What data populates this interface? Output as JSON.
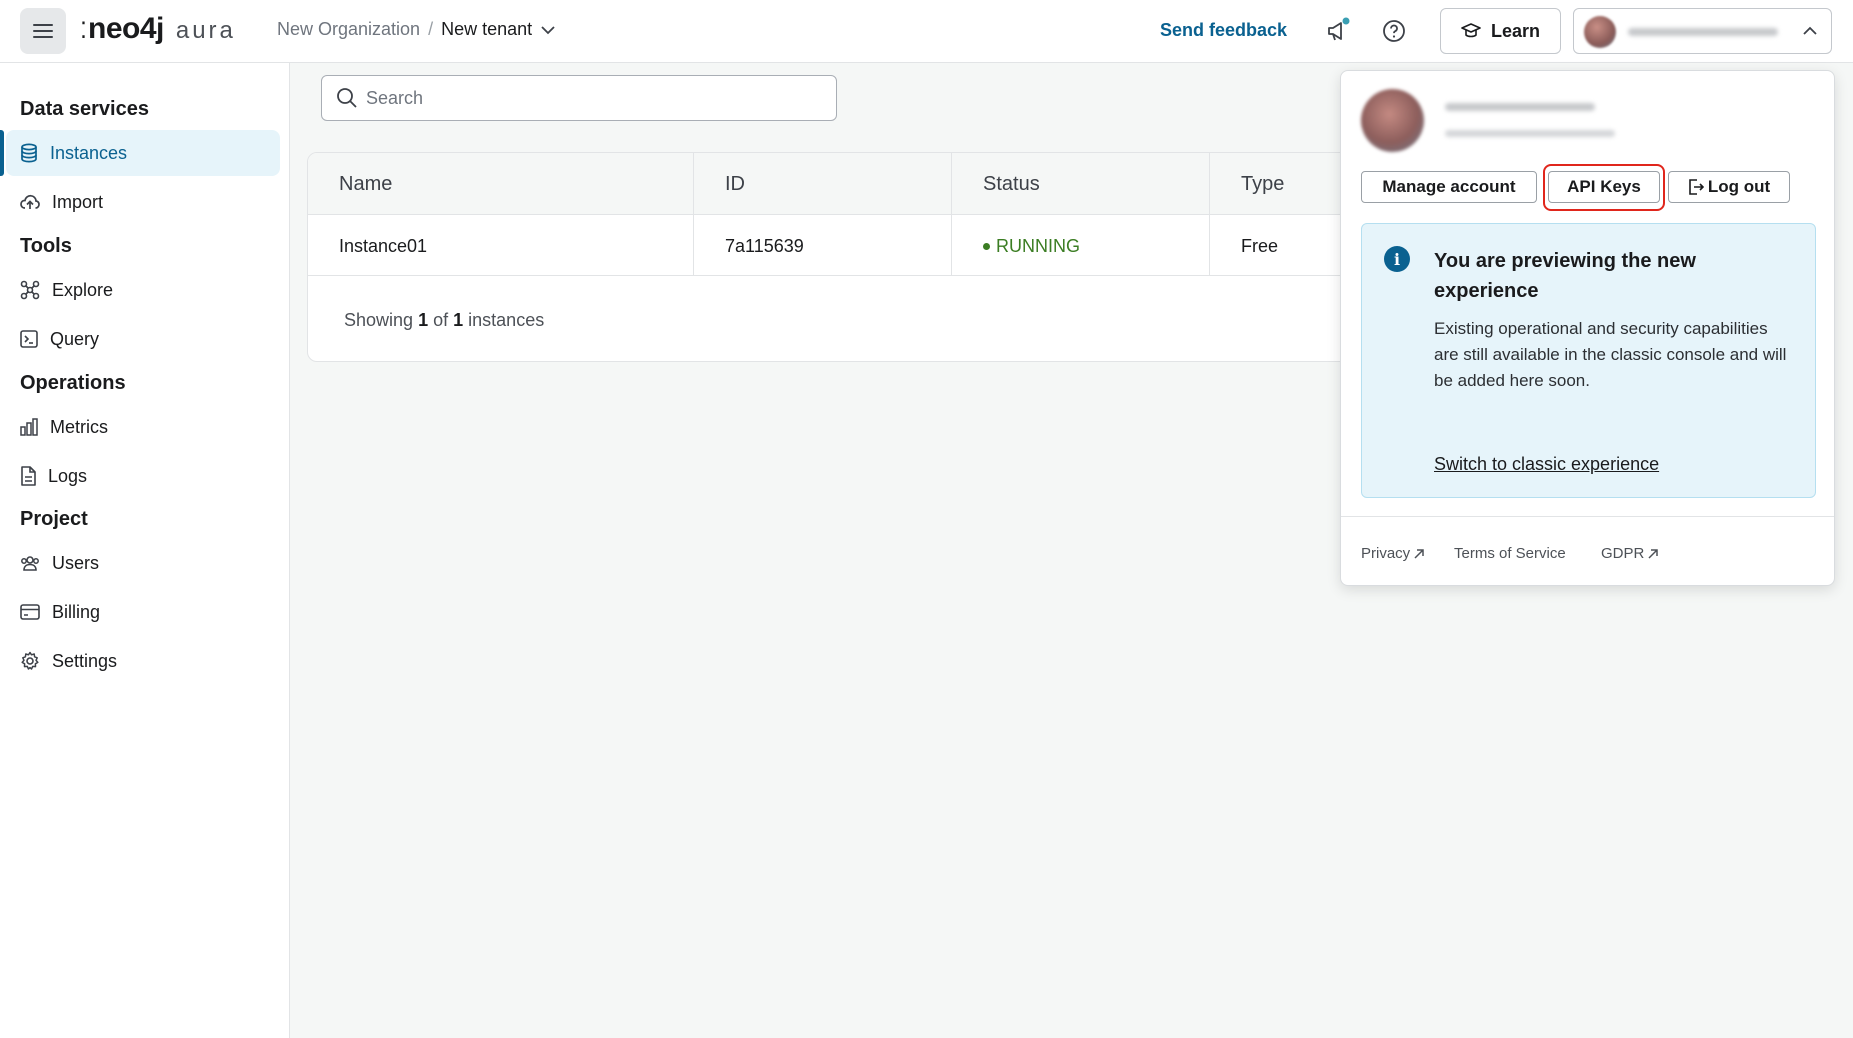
{
  "header": {
    "logo_brand": "neo4j",
    "logo_product": "aura",
    "breadcrumb_org": "New Organization",
    "breadcrumb_sep": "/",
    "breadcrumb_tenant": "New tenant",
    "send_feedback": "Send feedback",
    "learn": "Learn"
  },
  "sidebar": {
    "sections": [
      {
        "title": "Data services",
        "items": [
          {
            "label": "Instances",
            "icon": "database-icon"
          },
          {
            "label": "Import",
            "icon": "cloud-upload-icon"
          }
        ]
      },
      {
        "title": "Tools",
        "items": [
          {
            "label": "Explore",
            "icon": "graph-nodes-icon"
          },
          {
            "label": "Query",
            "icon": "terminal-icon"
          }
        ]
      },
      {
        "title": "Operations",
        "items": [
          {
            "label": "Metrics",
            "icon": "bar-chart-icon"
          },
          {
            "label": "Logs",
            "icon": "document-icon"
          }
        ]
      },
      {
        "title": "Project",
        "items": [
          {
            "label": "Users",
            "icon": "users-icon"
          },
          {
            "label": "Billing",
            "icon": "credit-card-icon"
          },
          {
            "label": "Settings",
            "icon": "gear-icon"
          }
        ]
      }
    ]
  },
  "search": {
    "placeholder": "Search"
  },
  "table": {
    "columns": [
      "Name",
      "ID",
      "Status",
      "Type"
    ],
    "rows": [
      {
        "name": "Instance01",
        "id": "7a115639",
        "status": "RUNNING",
        "type": "Free"
      }
    ],
    "footer": {
      "prefix": "Showing",
      "shown": "1",
      "of": "of",
      "total": "1",
      "suffix": "instances"
    }
  },
  "account_menu": {
    "manage_account": "Manage account",
    "api_keys": "API Keys",
    "log_out": "Log out",
    "preview_title": "You are previewing the new experience",
    "preview_body": "Existing operational and security capabilities are still available in the classic console and will be added here soon.",
    "switch_link": "Switch to classic experience",
    "footer_links": [
      "Privacy",
      "Terms of Service",
      "GDPR"
    ]
  },
  "colors": {
    "accent": "#0a6190",
    "status_running": "#3b7d23",
    "highlight": "#e0261c",
    "info_bg": "#e6f4fa"
  }
}
